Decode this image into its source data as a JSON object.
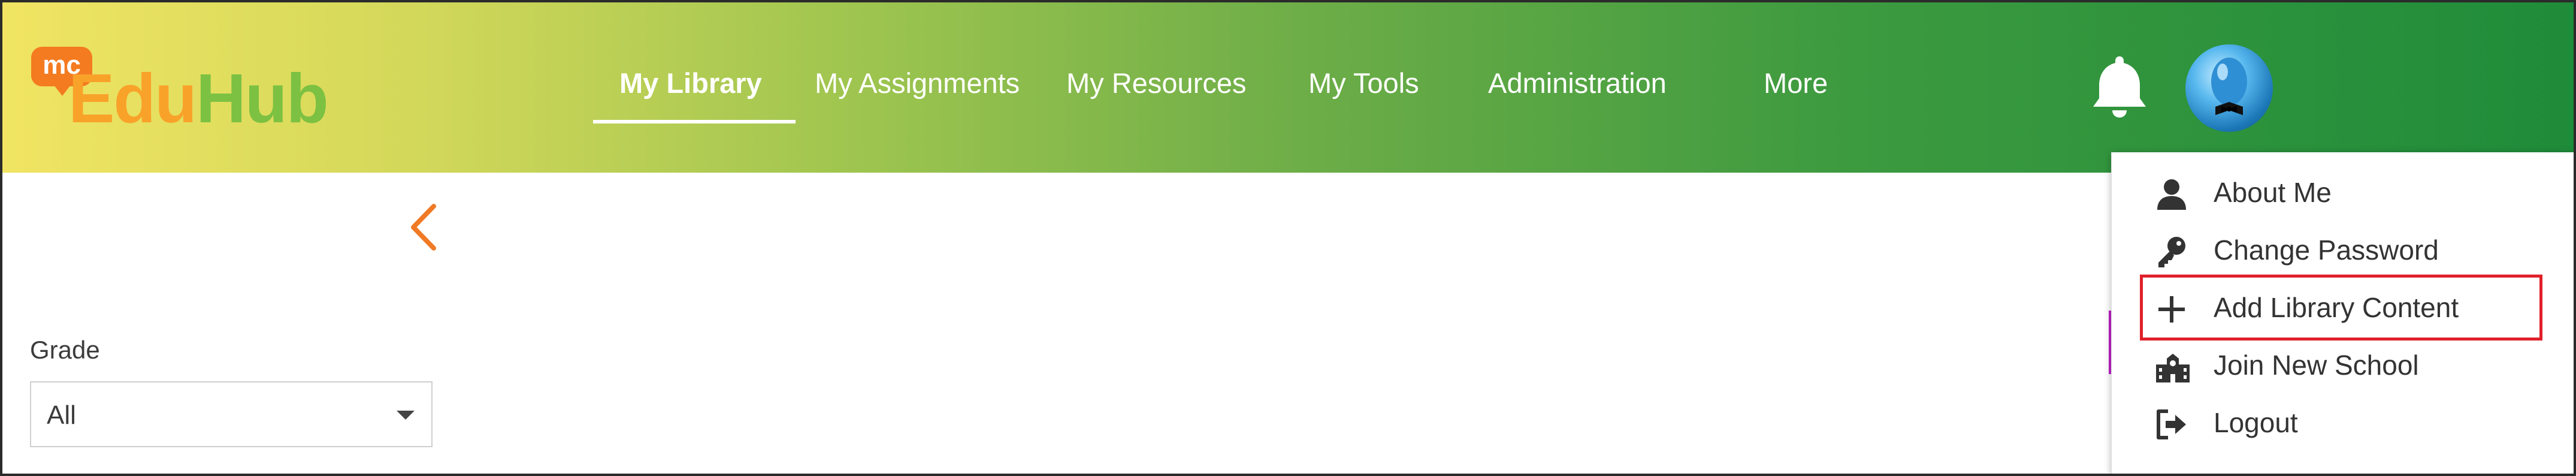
{
  "logo": {
    "badge": "mc",
    "text_edu": "Edu",
    "text_hub": "Hub"
  },
  "nav": {
    "items": [
      {
        "label": "My Library",
        "active": true
      },
      {
        "label": "My Assignments",
        "active": false
      },
      {
        "label": "My Resources",
        "active": false
      },
      {
        "label": "My Tools",
        "active": false
      },
      {
        "label": "Administration",
        "active": false
      },
      {
        "label": "More",
        "active": false
      }
    ]
  },
  "header_icons": {
    "notification": "bell-icon",
    "profile": "user-avatar"
  },
  "filters": {
    "grade_label": "Grade",
    "grade_value": "All"
  },
  "profile_menu": {
    "items": [
      {
        "label": "About Me",
        "icon": "user-icon"
      },
      {
        "label": "Change Password",
        "icon": "key-icon"
      },
      {
        "label": "Add Library Content",
        "icon": "plus-icon",
        "highlighted": true
      },
      {
        "label": "Join New School",
        "icon": "school-icon"
      },
      {
        "label": "Logout",
        "icon": "logout-icon"
      }
    ]
  },
  "colors": {
    "header_start": "#f1e463",
    "header_end": "#1f8c3a",
    "highlight": "#e0202a",
    "back_chevron": "#f07a25"
  }
}
